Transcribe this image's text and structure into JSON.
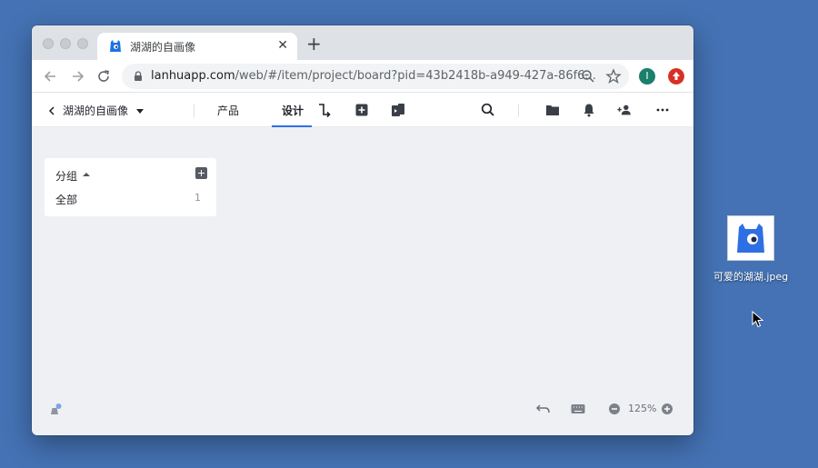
{
  "browser": {
    "tab_title": "湖湖的自画像",
    "close_glyph": "✕",
    "new_tab_glyph": "+",
    "url_host": "lanhuapp.com",
    "url_path": "/web/#/item/project/board?pid=43b2418b-a949-427a-86f6...",
    "profile_initial": "I",
    "profile_color": "#1a7f6b",
    "extension_color": "#d93025"
  },
  "app": {
    "project_name": "湖湖的自画像",
    "tabs": [
      {
        "label": "产品",
        "active": false
      },
      {
        "label": "设计",
        "active": true
      }
    ],
    "accent_color": "#2f6fe4"
  },
  "sidebar_panel": {
    "title": "分组",
    "rows": [
      {
        "label": "全部",
        "count": "1"
      }
    ]
  },
  "footer": {
    "zoom": "125%"
  },
  "desktop": {
    "file_name": "可爱的湖湖.jpeg"
  }
}
